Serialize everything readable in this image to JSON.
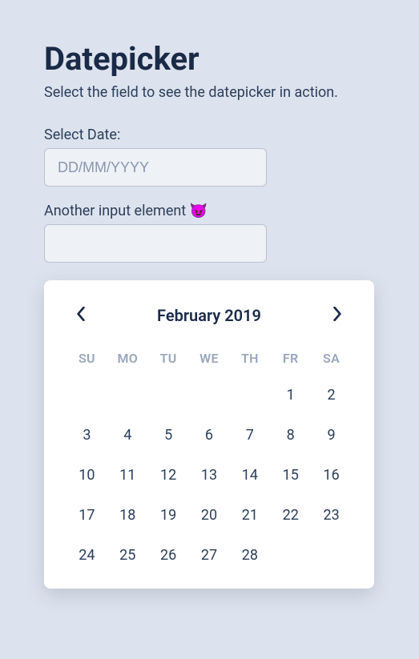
{
  "title": "Datepicker",
  "subtitle": "Select the field to see the datepicker in action.",
  "fields": {
    "date": {
      "label": "Select Date:",
      "placeholder": "DD/MM/YYYY",
      "value": ""
    },
    "other": {
      "label": "Another input element 😈",
      "placeholder": "",
      "value": ""
    }
  },
  "datepicker": {
    "month_label": "February 2019",
    "dow": [
      "Su",
      "Mo",
      "Tu",
      "We",
      "Th",
      "Fr",
      "Sa"
    ],
    "leading_blanks": 5,
    "days": [
      1,
      2,
      3,
      4,
      5,
      6,
      7,
      8,
      9,
      10,
      11,
      12,
      13,
      14,
      15,
      16,
      17,
      18,
      19,
      20,
      21,
      22,
      23,
      24,
      25,
      26,
      27,
      28
    ]
  }
}
